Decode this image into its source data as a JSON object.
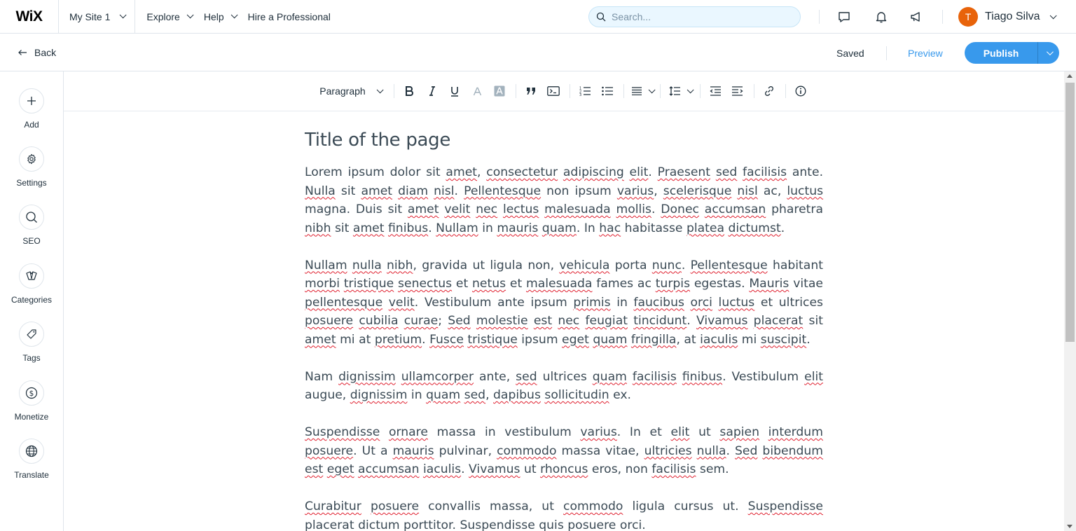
{
  "topbar": {
    "logo": "WiX",
    "site_name": "My Site 1",
    "nav": [
      "Explore",
      "Help",
      "Hire a Professional"
    ],
    "search_placeholder": "Search...",
    "user_name": "Tiago Silva",
    "user_initial": "T",
    "avatar_color": "#e8630a"
  },
  "subbar": {
    "back_label": "Back",
    "status": "Saved",
    "preview_label": "Preview",
    "publish_label": "Publish",
    "accent": "#3899ec"
  },
  "sidebar": {
    "items": [
      {
        "label": "Add",
        "icon": "plus-icon"
      },
      {
        "label": "Settings",
        "icon": "gear-icon"
      },
      {
        "label": "SEO",
        "icon": "search-icon"
      },
      {
        "label": "Categories",
        "icon": "categories-icon"
      },
      {
        "label": "Tags",
        "icon": "tag-icon"
      },
      {
        "label": "Monetize",
        "icon": "dollar-icon"
      },
      {
        "label": "Translate",
        "icon": "globe-icon"
      }
    ]
  },
  "toolbar": {
    "text_style": "Paragraph"
  },
  "editor": {
    "title": "Title of the page",
    "paragraphs": [
      "Lorem ipsum dolor sit amet, consectetur adipiscing elit. Praesent sed facilisis ante. Nulla sit amet diam nisl. Pellentesque non ipsum varius, scelerisque nisl ac, luctus magna. Duis sit amet velit nec lectus malesuada mollis. Donec accumsan pharetra nibh sit amet finibus. Nullam in mauris quam. In hac habitasse platea dictumst.",
      "Nullam nulla nibh, gravida ut ligula non, vehicula porta nunc. Pellentesque habitant morbi tristique senectus et netus et malesuada fames ac turpis egestas. Mauris vitae pellentesque velit. Vestibulum ante ipsum primis in faucibus orci luctus et ultrices posuere cubilia curae; Sed molestie est nec feugiat tincidunt. Vivamus placerat sit amet mi at pretium. Fusce tristique ipsum eget quam fringilla, at iaculis mi suscipit.",
      "Nam dignissim ullamcorper ante, sed ultrices quam facilisis finibus. Vestibulum elit augue, dignissim in quam sed, dapibus sollicitudin ex.",
      "Suspendisse ornare massa in vestibulum varius. In et elit ut sapien interdum posuere. Ut a mauris pulvinar, commodo massa vitae, ultricies nulla. Sed bibendum est eget accumsan iaculis. Vivamus ut rhoncus eros, non facilisis sem.",
      "Curabitur posuere convallis massa, ut commodo ligula cursus ut. Suspendisse placerat dictum porttitor. Suspendisse quis posuere orci."
    ],
    "misspelled": [
      "amet",
      "consectetur",
      "adipiscing",
      "elit",
      "Praesent",
      "sed",
      "facilisis",
      "Nulla",
      "diam",
      "nisl",
      "Pellentesque",
      "varius",
      "scelerisque",
      "luctus",
      "velit",
      "nec",
      "lectus",
      "malesuada",
      "mollis",
      "Donec",
      "accumsan",
      "nibh",
      "finibus",
      "Nullam",
      "mauris",
      "quam",
      "hac",
      "platea",
      "dictumst",
      "nulla",
      "vehicula",
      "nunc",
      "morbi",
      "tristique",
      "senectus",
      "netus",
      "turpis",
      "Mauris",
      "pellentesque",
      "primis",
      "faucibus",
      "orci",
      "posuere",
      "cubilia",
      "curae",
      "Sed",
      "molestie",
      "est",
      "feugiat",
      "tincidunt",
      "Vivamus",
      "placerat",
      "pretium",
      "Fusce",
      "eget",
      "fringilla",
      "iaculis",
      "suscipit",
      "dignissim",
      "ullamcorper",
      "dapibus",
      "sollicitudin",
      "Suspendisse",
      "ornare",
      "sapien",
      "interdum",
      "commodo",
      "ultricies",
      "bibendum",
      "rhoncus",
      "Curabitur"
    ]
  }
}
